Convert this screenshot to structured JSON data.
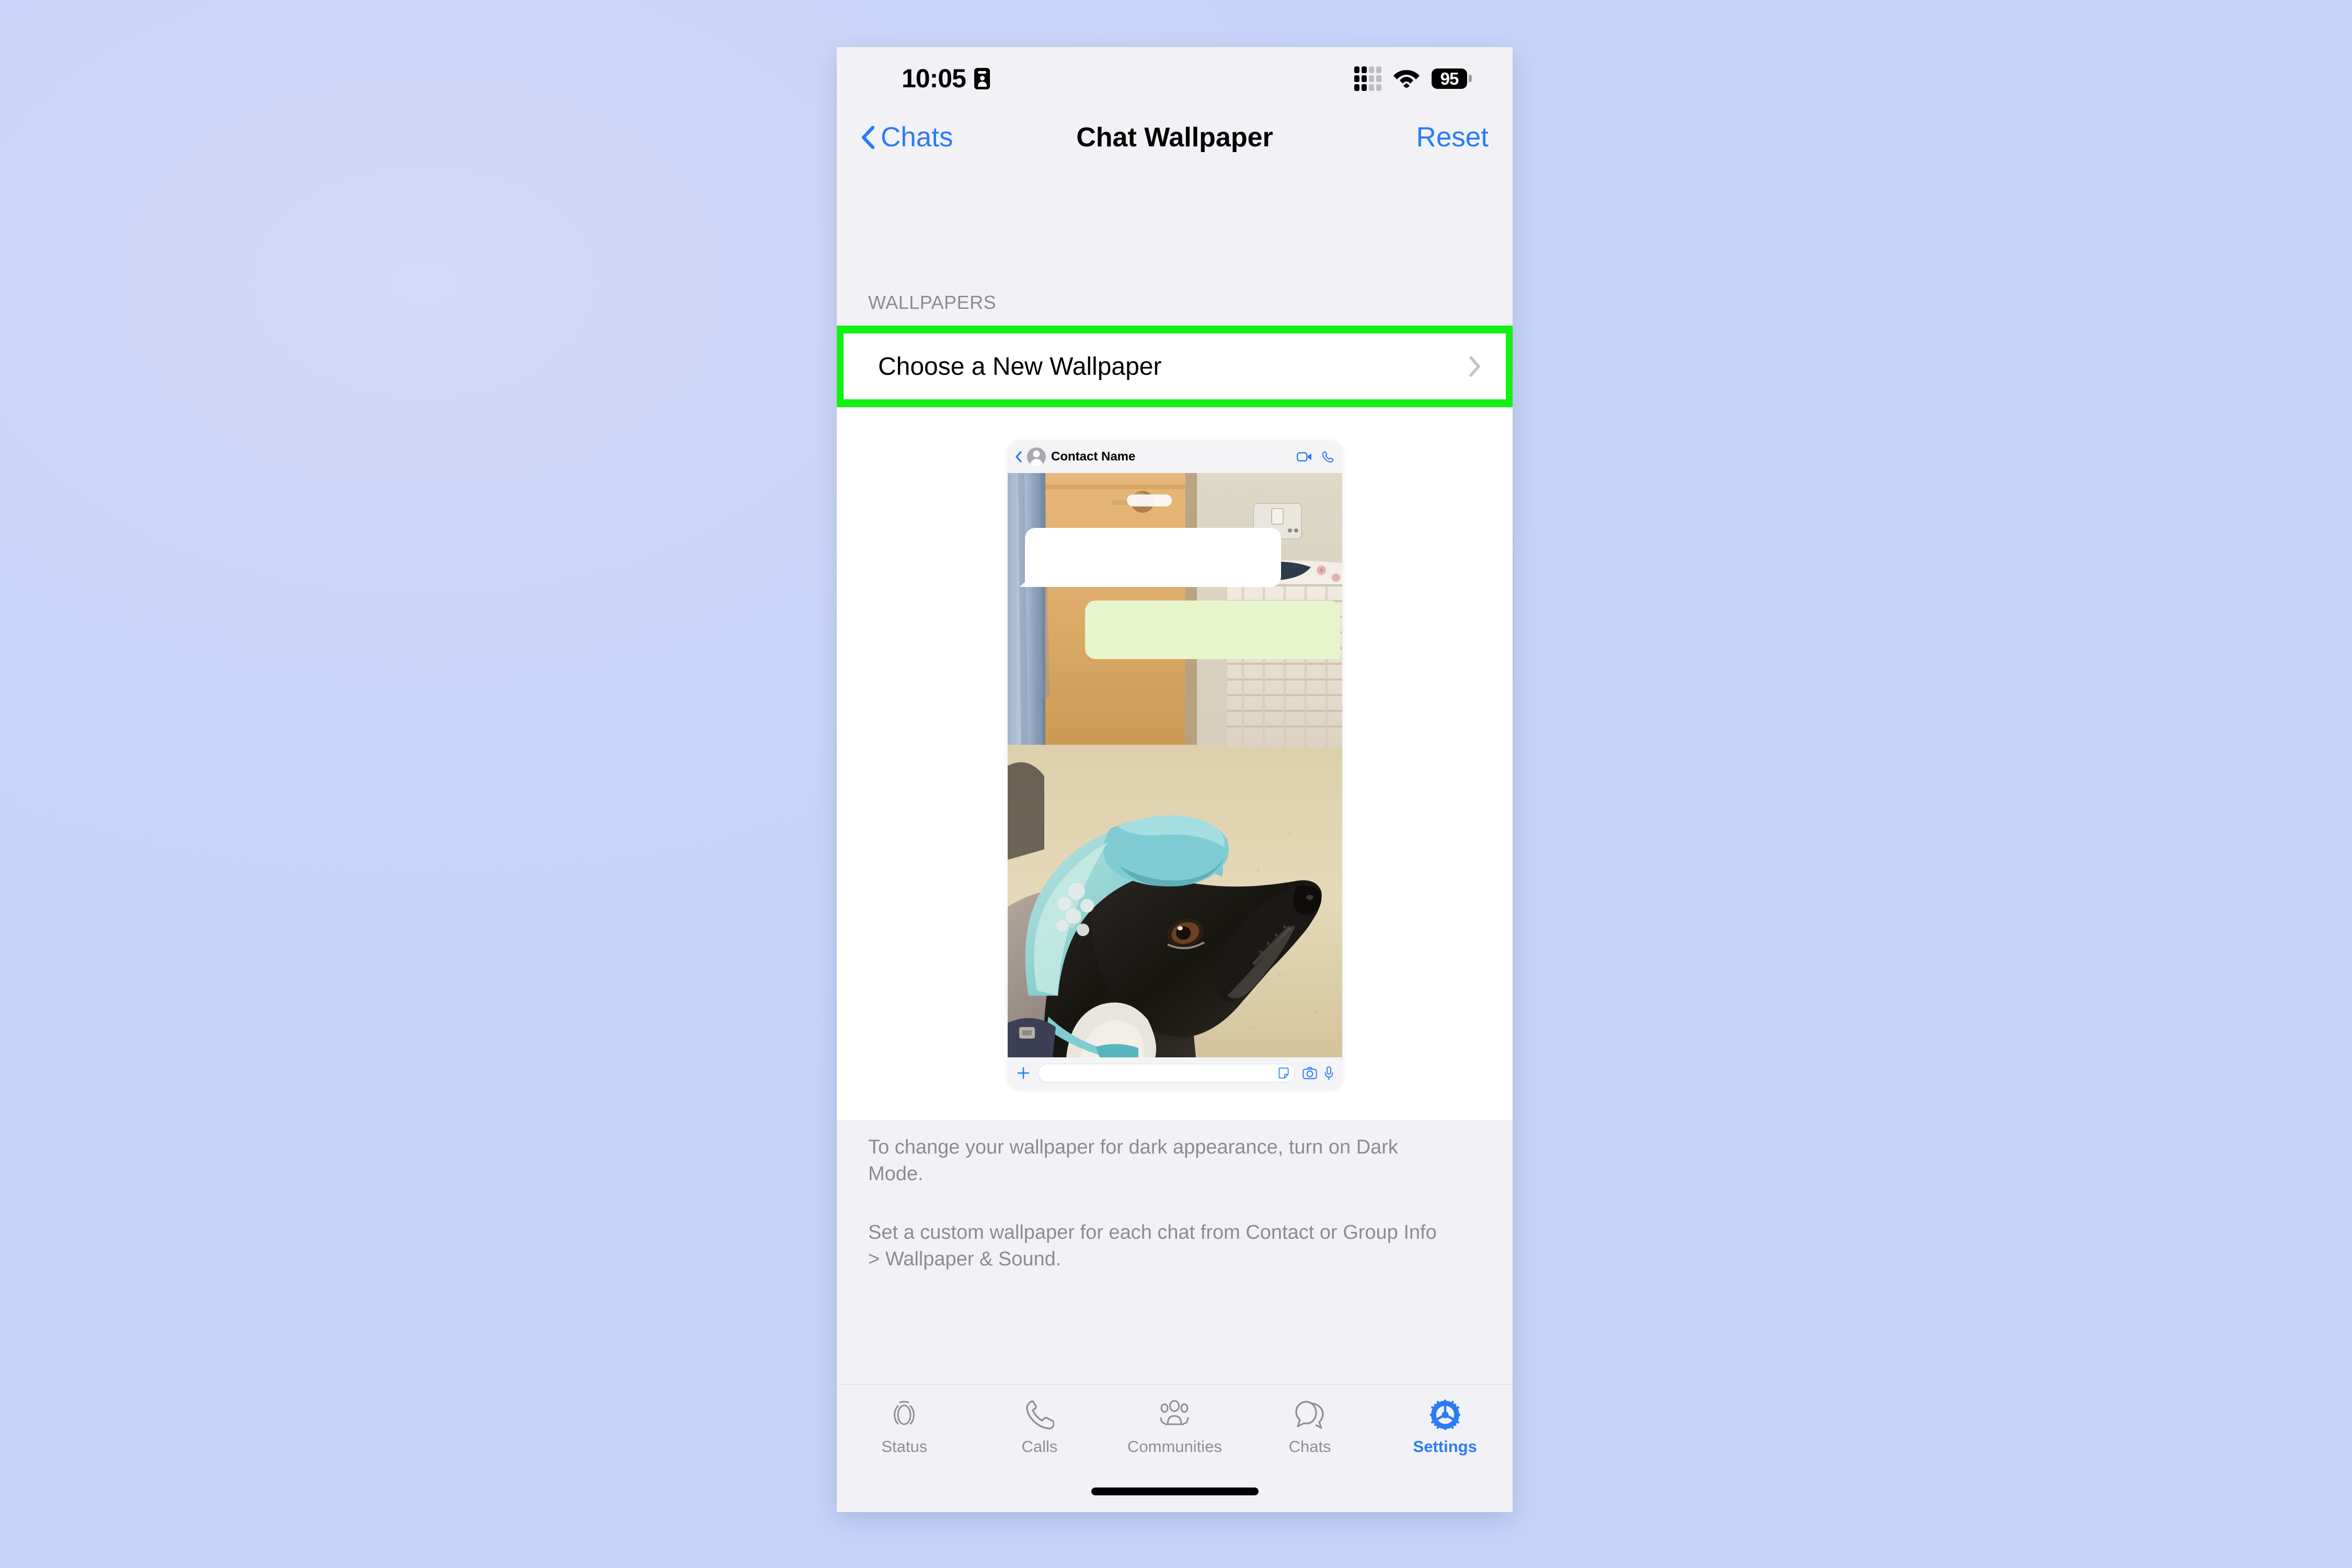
{
  "page": {
    "background_color": "#c9d6f7",
    "screen_background": "#f2f2f6",
    "accent_color": "#2b7bf6",
    "highlight_color": "#13f013"
  },
  "status_bar": {
    "time": "10:05",
    "badge_icon": "id-card-icon",
    "signal_icon": "cellular-signal-icon",
    "wifi_icon": "wifi-icon",
    "battery_percent": "95"
  },
  "nav_bar": {
    "back_label": "Chats",
    "back_icon": "chevron-left-icon",
    "title": "Chat Wallpaper",
    "action_label": "Reset"
  },
  "section": {
    "header": "WALLPAPERS",
    "row_label": "Choose a New Wallpaper",
    "row_chevron": "chevron-right-icon"
  },
  "chat_preview": {
    "back_icon": "chevron-left-icon",
    "avatar_icon": "person-avatar-icon",
    "contact_name": "Contact Name",
    "video_call_icon": "video-camera-icon",
    "voice_call_icon": "phone-icon",
    "wallpaper_description": "Photo of a black greyhound wearing a turquoise sun visor hat indoors",
    "incoming_bubble_color": "#ffffff",
    "outgoing_bubble_color": "#e8f5cc",
    "input_bar": {
      "plus_icon": "plus-icon",
      "text_placeholder": "",
      "sticker_icon": "sticker-icon",
      "camera_icon": "camera-icon",
      "mic_icon": "microphone-icon"
    }
  },
  "footer": {
    "paragraph_1": "To change your wallpaper for dark appearance, turn on Dark Mode.",
    "paragraph_2": "Set a custom wallpaper for each chat from Contact or Group Info > Wallpaper & Sound."
  },
  "tab_bar": {
    "items": [
      {
        "label": "Status",
        "icon": "status-rings-icon",
        "active": false
      },
      {
        "label": "Calls",
        "icon": "phone-icon",
        "active": false
      },
      {
        "label": "Communities",
        "icon": "communities-icon",
        "active": false
      },
      {
        "label": "Chats",
        "icon": "chat-bubbles-icon",
        "active": false
      },
      {
        "label": "Settings",
        "icon": "gear-icon",
        "active": true
      }
    ]
  }
}
